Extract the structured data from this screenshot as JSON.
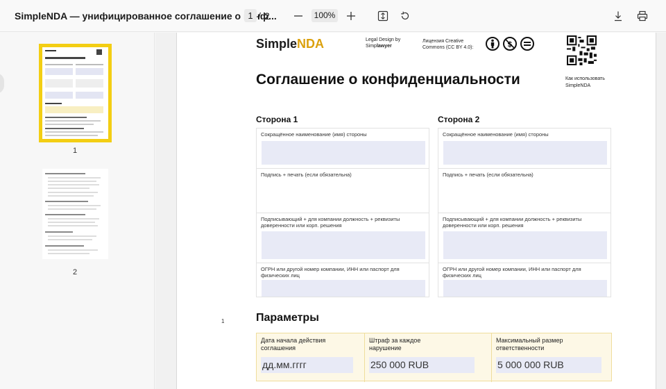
{
  "toolbar": {
    "title": "SimpleNDA — унифицированное соглашение о конф...",
    "current_page": "1",
    "page_separator": "/",
    "total_pages": "2",
    "zoom": "100%"
  },
  "sidebar": {
    "thumbnails": [
      {
        "label": "1",
        "selected": true
      },
      {
        "label": "2",
        "selected": false
      }
    ],
    "highlight_color": "#f3ce13"
  },
  "document": {
    "margin_number": "1",
    "brand_prefix": "Simple",
    "brand_suffix": "NDA",
    "legal_line1": "Legal Design by",
    "legal_line2_a": "Simp",
    "legal_line2_b": "lawyer",
    "license": "Лицензия Creative Commons (CC BY 4.0):",
    "cc_icons": [
      "BY",
      "NC",
      "ND"
    ],
    "howto": "Как использовать SimpleNDA",
    "title": "Соглашение о конфиденциальности",
    "party1": "Сторона 1",
    "party2": "Сторона 2",
    "fields": {
      "short_name": "Сокращённое наименование (имя) стороны",
      "signature": "Подпись + печать (если обязательна)",
      "signatory": "Подписывающий + для компании должность + реквизиты доверенности или корп. решения",
      "ogrn": "ОГРН или другой номер компании, ИНН или паспорт для физических лиц"
    },
    "params_heading": "Параметры",
    "params": [
      {
        "label": "Дата начала действия соглашения",
        "value": "дд.мм.гггг"
      },
      {
        "label": "Штраф за каждое нарушение",
        "value": "250 000 RUB"
      },
      {
        "label": "Максимальный размер ответственности",
        "value": "5 000 000 RUB"
      }
    ]
  }
}
